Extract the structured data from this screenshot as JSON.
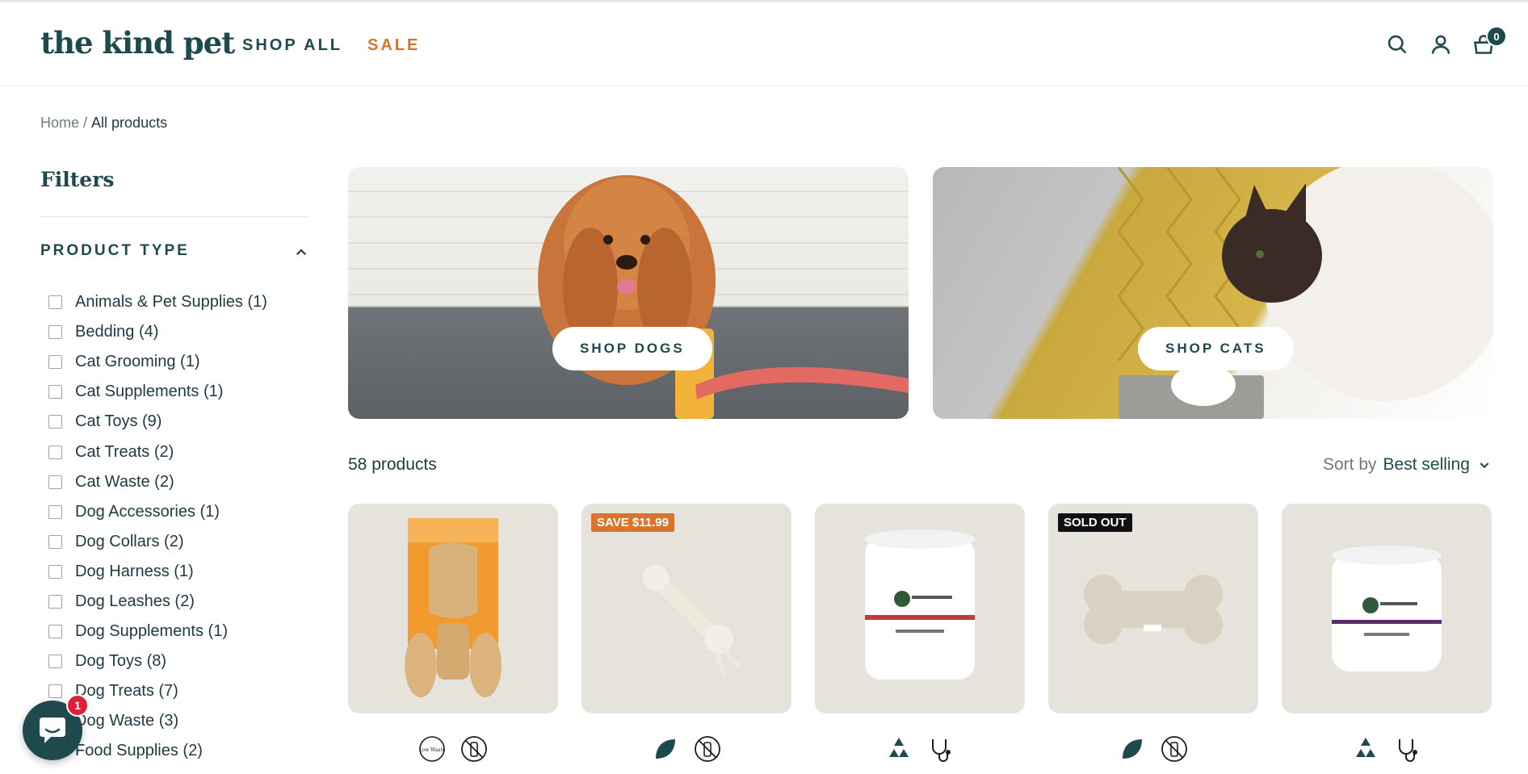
{
  "header": {
    "logo": "the kind pet",
    "nav": {
      "shop_all": "SHOP ALL",
      "sale": "SALE"
    },
    "icons": [
      "search-icon",
      "account-icon",
      "cart-icon"
    ],
    "cart_count": "0"
  },
  "breadcrumb": {
    "home": "Home",
    "separator": "/",
    "current": "All products"
  },
  "filters": {
    "title": "Filters",
    "section_title": "PRODUCT TYPE",
    "items": [
      "Animals & Pet Supplies (1)",
      "Bedding (4)",
      "Cat Grooming (1)",
      "Cat Supplements (1)",
      "Cat Toys (9)",
      "Cat Treats (2)",
      "Cat Waste (2)",
      "Dog Accessories (1)",
      "Dog Collars (2)",
      "Dog Harness (1)",
      "Dog Leashes (2)",
      "Dog Supplements (1)",
      "Dog Toys (8)",
      "Dog Treats (7)",
      "Dog Waste (3)",
      "Food Supplies (2)"
    ]
  },
  "banners": {
    "dogs": {
      "label": "SHOP DOGS"
    },
    "cats": {
      "label": "SHOP CATS"
    }
  },
  "products_toolbar": {
    "count": "58 products",
    "sort_label": "Sort by",
    "sort_value": "Best selling"
  },
  "products": [
    {
      "badge": "",
      "icons": [
        "low-waste-icon",
        "no-plastic-icon"
      ]
    },
    {
      "badge": "SAVE $11.99",
      "icons": [
        "leaf-icon",
        "no-plastic-icon"
      ]
    },
    {
      "badge": "",
      "icons": [
        "recycle-icon",
        "vet-stethoscope-icon"
      ]
    },
    {
      "badge": "SOLD OUT",
      "icons": [
        "leaf-icon",
        "no-plastic-icon"
      ]
    },
    {
      "badge": "",
      "icons": [
        "recycle-icon",
        "vet-stethoscope-icon"
      ]
    }
  ],
  "low_waste_text": "Low Waste",
  "chat": {
    "unread": "1"
  },
  "colors": {
    "brand": "#1f4a4d",
    "sale": "#d8742b",
    "card_bg": "#e5e3dc",
    "chat_badge": "#e0203b"
  }
}
